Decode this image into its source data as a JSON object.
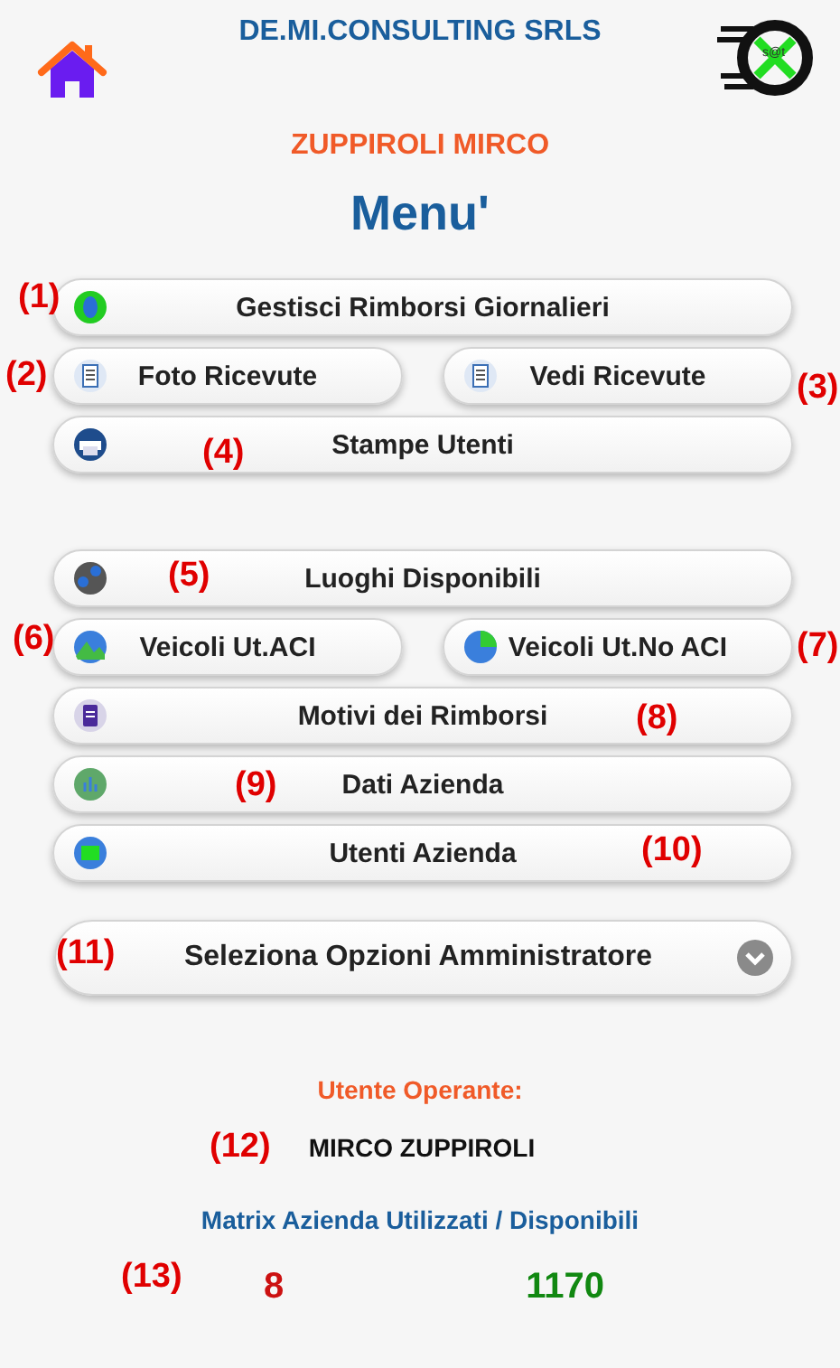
{
  "header": {
    "company": "DE.MI.CONSULTING SRLS",
    "logo_text": "s@t",
    "user_name": "ZUPPIROLI MIRCO",
    "title": "Menu'"
  },
  "groups": [
    {
      "rows": [
        {
          "buttons": [
            {
              "label": "Gestisci Rimborsi Giornalieri"
            }
          ]
        },
        {
          "buttons": [
            {
              "label": "Foto Ricevute"
            },
            {
              "label": "Vedi Ricevute"
            }
          ]
        },
        {
          "buttons": [
            {
              "label": "Stampe Utenti"
            }
          ]
        }
      ]
    },
    {
      "rows": [
        {
          "buttons": [
            {
              "label": "Luoghi Disponibili"
            }
          ]
        },
        {
          "buttons": [
            {
              "label": "Veicoli Ut.ACI"
            },
            {
              "label": "Veicoli Ut.No ACI"
            }
          ]
        },
        {
          "buttons": [
            {
              "label": "Motivi dei Rimborsi"
            }
          ]
        },
        {
          "buttons": [
            {
              "label": "Dati Azienda"
            }
          ]
        },
        {
          "buttons": [
            {
              "label": "Utenti Azienda"
            }
          ]
        }
      ]
    }
  ],
  "admin_select": {
    "label": "Seleziona Opzioni Amministratore"
  },
  "operator": {
    "label": "Utente Operante:",
    "name": "MIRCO ZUPPIROLI"
  },
  "matrix": {
    "label": "Matrix Azienda Utilizzati / Disponibili",
    "used": "8",
    "available": "1170"
  },
  "annotations": [
    "(1)",
    "(2)",
    "(3)",
    "(4)",
    "(5)",
    "(6)",
    "(7)",
    "(8)",
    "(9)",
    "(10)",
    "(11)",
    "(12)",
    "(13)"
  ]
}
